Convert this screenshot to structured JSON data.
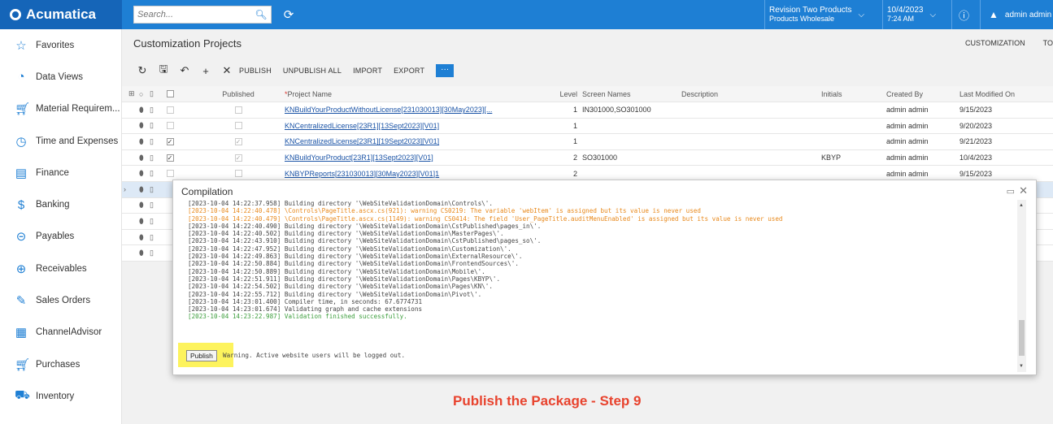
{
  "topbar": {
    "app_name": "Acumatica",
    "search_placeholder": "Search...",
    "company_line1": "Revision Two Products",
    "company_line2": "Products Wholesale",
    "date": "10/4/2023",
    "time": "7:24 AM",
    "user": "admin admin"
  },
  "sidebar": {
    "items": [
      {
        "label": "Favorites",
        "icon": "star-icon"
      },
      {
        "label": "Data Views",
        "icon": "pie-chart-icon"
      },
      {
        "label": "Material Requirem...",
        "icon": "cart-icon"
      },
      {
        "label": "Time and Expenses",
        "icon": "clock-icon"
      },
      {
        "label": "Finance",
        "icon": "calculator-icon"
      },
      {
        "label": "Banking",
        "icon": "dollar-icon"
      },
      {
        "label": "Payables",
        "icon": "minus-circle-icon"
      },
      {
        "label": "Receivables",
        "icon": "plus-circle-icon"
      },
      {
        "label": "Sales Orders",
        "icon": "pencil-icon"
      },
      {
        "label": "ChannelAdvisor",
        "icon": "grid-icon"
      },
      {
        "label": "Purchases",
        "icon": "cart-icon"
      },
      {
        "label": "Inventory",
        "icon": "truck-icon"
      }
    ]
  },
  "main": {
    "title": "Customization Projects",
    "top_links": [
      "CUSTOMIZATION",
      "TO"
    ],
    "toolbar": {
      "publish": "PUBLISH",
      "unpublish_all": "UNPUBLISH ALL",
      "import": "IMPORT",
      "export": "EXPORT",
      "more": "···"
    }
  },
  "grid": {
    "headers": {
      "published": "Published",
      "project_name": "Project Name",
      "level": "Level",
      "screen_names": "Screen Names",
      "description": "Description",
      "initials": "Initials",
      "created_by": "Created By",
      "last_modified": "Last Modified On"
    },
    "rows": [
      {
        "checked": false,
        "published": false,
        "name": "KNBuildYourProductWithoutLicense[231030013][30May2023][...",
        "level": "1",
        "screens": "IN301000,SO301000",
        "initials": "",
        "created_by": "admin admin",
        "modified": "9/15/2023"
      },
      {
        "checked": false,
        "published": false,
        "name": "KNCentralizedLicense[23R1][13Sept2023][V01]",
        "level": "1",
        "screens": "",
        "initials": "",
        "created_by": "admin admin",
        "modified": "9/20/2023"
      },
      {
        "checked": true,
        "published": true,
        "name": "KNCentralizedLicense[23R1][19Sept2023][V01]",
        "level": "1",
        "screens": "",
        "initials": "",
        "created_by": "admin admin",
        "modified": "9/21/2023"
      },
      {
        "checked": true,
        "published": true,
        "name": "KNBuildYourProduct[23R1][13Sept2023][V01]",
        "level": "2",
        "screens": "SO301000",
        "initials": "KBYP",
        "created_by": "admin admin",
        "modified": "10/4/2023"
      },
      {
        "checked": false,
        "published": false,
        "name": "KNBYPReports[231030013][30May2023][V01]1",
        "level": "2",
        "screens": "",
        "initials": "",
        "created_by": "admin admin",
        "modified": "9/15/2023"
      }
    ]
  },
  "dialog": {
    "title": "Compilation",
    "log": [
      {
        "t": "[2023-10-04 14:22:37.958] Building directory '\\WebSiteValidationDomain\\Controls\\'.",
        "k": "n"
      },
      {
        "t": "[2023-10-04 14:22:40.478] \\Controls\\PageTitle.ascx.cs(921): warning CS0219: The variable 'webItem' is assigned but its value is never used",
        "k": "w"
      },
      {
        "t": "[2023-10-04 14:22:40.479] \\Controls\\PageTitle.ascx.cs(1149): warning CS0414: The field 'User_PageTitle.auditMenuEnabled' is assigned but its value is never used",
        "k": "w"
      },
      {
        "t": "[2023-10-04 14:22:40.490] Building directory '\\WebSiteValidationDomain\\CstPublished\\pages_in\\'.",
        "k": "n"
      },
      {
        "t": "[2023-10-04 14:22:40.502] Building directory '\\WebSiteValidationDomain\\MasterPages\\'.",
        "k": "n"
      },
      {
        "t": "[2023-10-04 14:22:43.910] Building directory '\\WebSiteValidationDomain\\CstPublished\\pages_so\\'.",
        "k": "n"
      },
      {
        "t": "[2023-10-04 14:22:47.952] Building directory '\\WebSiteValidationDomain\\Customization\\'.",
        "k": "n"
      },
      {
        "t": "[2023-10-04 14:22:49.863] Building directory '\\WebSiteValidationDomain\\ExternalResource\\'.",
        "k": "n"
      },
      {
        "t": "[2023-10-04 14:22:50.884] Building directory '\\WebSiteValidationDomain\\FrontendSources\\'.",
        "k": "n"
      },
      {
        "t": "[2023-10-04 14:22:50.889] Building directory '\\WebSiteValidationDomain\\Mobile\\'.",
        "k": "n"
      },
      {
        "t": "[2023-10-04 14:22:51.911] Building directory '\\WebSiteValidationDomain\\Pages\\KBYP\\'.",
        "k": "n"
      },
      {
        "t": "[2023-10-04 14:22:54.502] Building directory '\\WebSiteValidationDomain\\Pages\\KN\\'.",
        "k": "n"
      },
      {
        "t": "[2023-10-04 14:22:55.712] Building directory '\\WebSiteValidationDomain\\Pivot\\'.",
        "k": "n"
      },
      {
        "t": "[2023-10-04 14:23:01.400] Compiler time, in seconds: 67.6774731",
        "k": "n"
      },
      {
        "t": "[2023-10-04 14:23:01.674] Validating graph and cache extensions",
        "k": "n"
      },
      {
        "t": "[2023-10-04 14:23:22.987] Validation finished successfully.",
        "k": "s"
      }
    ],
    "publish_label": "Publish",
    "warning": "Warning. Active website users will be logged out."
  },
  "caption": "Publish the Package - Step 9",
  "colors": {
    "brand": "#1e7fd4",
    "highlight": "#fdf35d",
    "caption": "#e8432e",
    "warning": "#e8891c",
    "success": "#3b9d3b"
  }
}
